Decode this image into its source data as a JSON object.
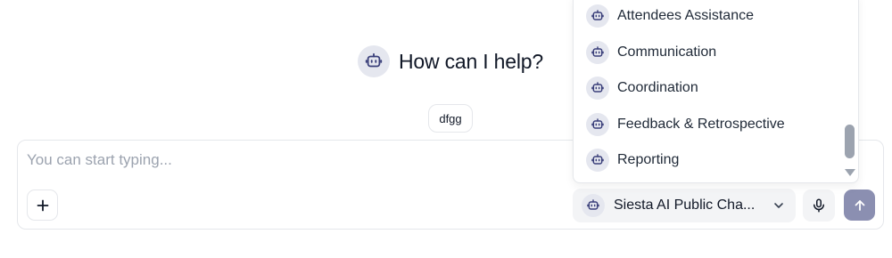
{
  "greeting": {
    "text": "How can I help?",
    "icon": "robot-icon"
  },
  "suggestions": [
    {
      "label": "dfgg"
    }
  ],
  "composer": {
    "input": {
      "placeholder": "You can start typing...",
      "value": ""
    },
    "add_icon": "plus-icon",
    "assistant_select": {
      "selected": "Siesta AI Public Cha...",
      "icon": "robot-icon",
      "chevron": "chevron-down-icon"
    },
    "mic_icon": "microphone-icon",
    "send_icon": "arrow-up-icon"
  },
  "assistant_dropdown": {
    "items": [
      {
        "label": "Attendees Assistance"
      },
      {
        "label": "Communication"
      },
      {
        "label": "Coordination"
      },
      {
        "label": "Feedback & Retrospective"
      },
      {
        "label": "Reporting"
      }
    ]
  },
  "colors": {
    "avatar_bg": "#e5e7ef",
    "avatar_icon": "#3a3f7a",
    "send_button": "#8b8fb1",
    "border": "#e5e7eb",
    "placeholder": "#9ca3af",
    "select_bg": "#f3f4f6"
  }
}
